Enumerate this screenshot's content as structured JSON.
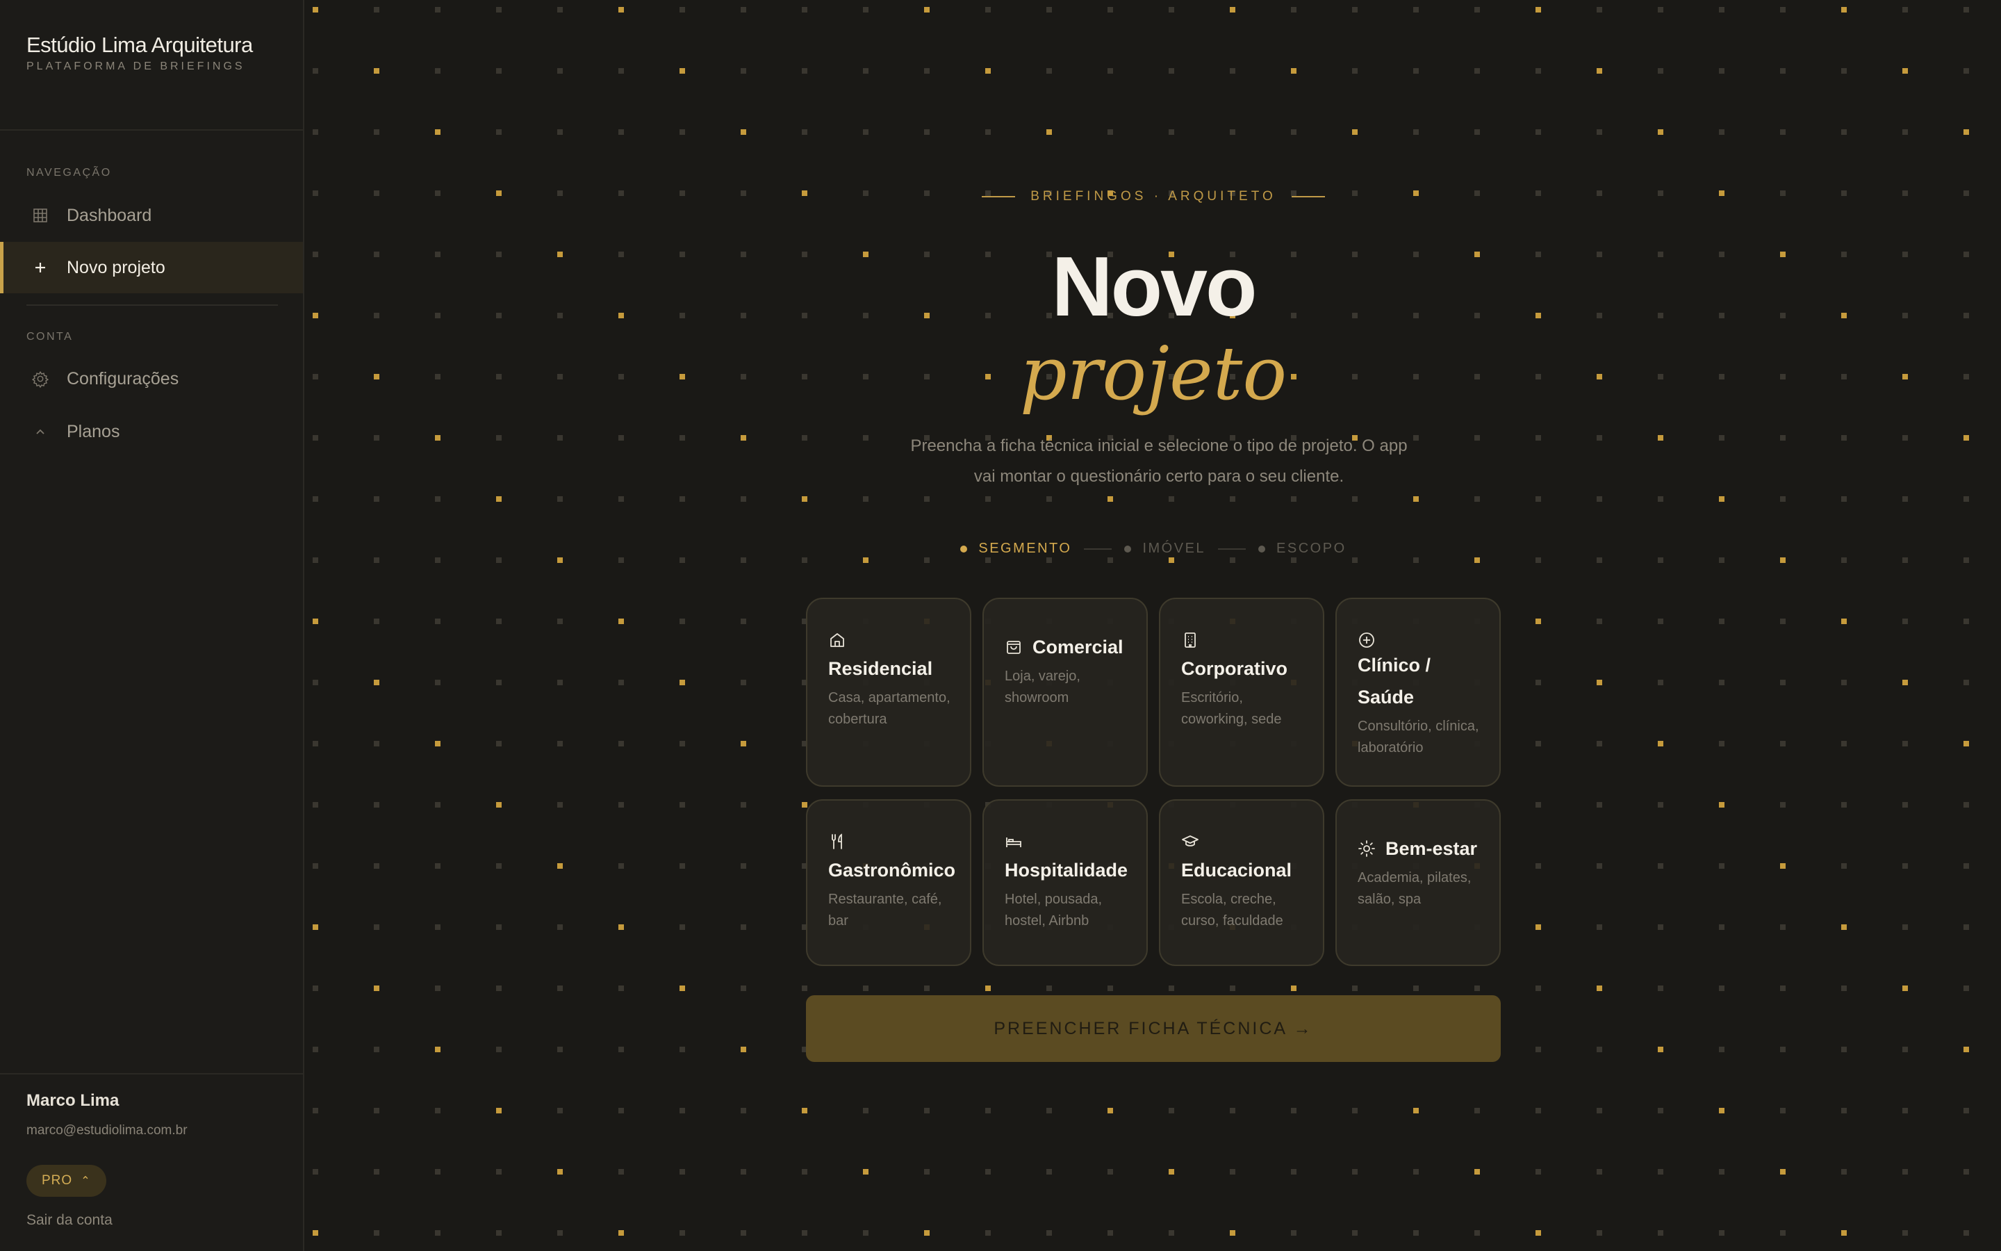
{
  "sidebar": {
    "brand_name": "Estúdio Lima Arquitetura",
    "brand_sub": "PLATAFORMA DE BRIEFINGS",
    "nav_section_label": "NAVEGAÇÃO",
    "nav_items": [
      {
        "label": "Dashboard",
        "icon": "grid-icon",
        "active": false
      },
      {
        "label": "Novo projeto",
        "icon": "plus-icon",
        "active": true
      }
    ],
    "account_section_label": "CONTA",
    "account_items": [
      {
        "label": "Configurações",
        "icon": "gear-icon"
      },
      {
        "label": "Planos",
        "icon": "chevron-up-icon"
      }
    ],
    "user": {
      "name": "Marco Lima",
      "email": "marco@estudiolima.com.br",
      "plan": "PRO",
      "logout": "Sair da conta"
    }
  },
  "main": {
    "eyebrow": "BRIEFINGOS · ARQUITETO",
    "title": "Novo",
    "title_accent": "projeto",
    "lead": "Preencha a ficha técnica inicial e selecione o tipo de projeto. O app vai montar o questionário certo para o seu cliente.",
    "steps": [
      {
        "label": "SEGMENTO",
        "active": true
      },
      {
        "label": "IMÓVEL",
        "active": false
      },
      {
        "label": "ESCOPO",
        "active": false
      }
    ],
    "segments": [
      {
        "name": "Residencial",
        "desc": "Casa, apartamento, cobertura",
        "icon": "house-icon"
      },
      {
        "name": "Comercial",
        "desc": "Loja, varejo, showroom",
        "icon": "shopping-bag-icon"
      },
      {
        "name": "Corporativo",
        "desc": "Escritório, coworking, sede",
        "icon": "building-icon"
      },
      {
        "name": "Clínico / Saúde",
        "desc": "Consultório, clínica, laboratório",
        "icon": "plus-circle-icon"
      },
      {
        "name": "Gastronômico",
        "desc": "Restaurante, café, bar",
        "icon": "utensils-icon"
      },
      {
        "name": "Hospitalidade",
        "desc": "Hotel, pousada, hostel, Airbnb",
        "icon": "bed-icon"
      },
      {
        "name": "Educacional",
        "desc": "Escola, creche, curso, faculdade",
        "icon": "graduation-cap-icon"
      },
      {
        "name": "Bem-estar",
        "desc": "Academia, pilates, salão, spa",
        "icon": "sun-icon"
      }
    ],
    "cta_label": "PREENCHER FICHA TÉCNICA →"
  },
  "colors": {
    "background": "#1a1916",
    "accent": "#d4a94e",
    "card_border": "#3e3a2c",
    "cta_bg": "#5b4b22"
  }
}
